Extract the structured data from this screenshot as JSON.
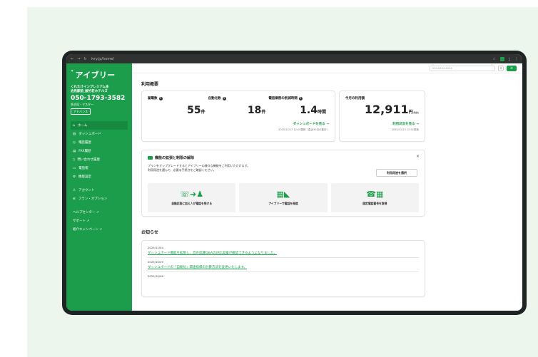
{
  "browser": {
    "url": "ivry.jp/home/"
  },
  "sidebar": {
    "logo": "アイブリー",
    "shop_line1": "くれたけインプレミアム多",
    "shop_line2": "治見駅前_飯竹荘ホテルズ",
    "phone": "050-1793-3582",
    "shop_sub": "多治見・マスター",
    "badge": "アドバンス",
    "items": [
      {
        "label": "ホーム",
        "icon": "home-icon"
      },
      {
        "label": "ダッシュボード",
        "icon": "chart-icon"
      },
      {
        "label": "電話履歴",
        "icon": "clock-icon"
      },
      {
        "label": "FAX履歴",
        "icon": "fax-icon"
      },
      {
        "label": "問い合わせ履歴",
        "icon": "document-icon"
      },
      {
        "label": "電話帳",
        "icon": "book-icon"
      },
      {
        "label": "機能設定",
        "icon": "gear-icon"
      }
    ],
    "items2": [
      {
        "label": "アカウント",
        "icon": "user-icon"
      },
      {
        "label": "プラン・オプション",
        "icon": "plan-icon"
      }
    ],
    "links": [
      {
        "label": "ヘルプセンター"
      },
      {
        "label": "サポート"
      },
      {
        "label": "紹介キャンペーン"
      }
    ]
  },
  "topbar": {
    "search_placeholder": "050-XXXX-XXXX"
  },
  "usage": {
    "title": "利用概要",
    "incoming_label": "着電数",
    "incoming_value": "55",
    "incoming_unit": "件",
    "auto_label": "自動化数",
    "auto_value": "18",
    "auto_unit": "件",
    "reduction_label": "電話業務の削減時間",
    "reduction_value": "1.4",
    "reduction_unit": "時間",
    "dashboard_link": "ダッシュボードを見る →",
    "dashboard_note": "2025/12/13 12:00更新（直近30日の集計）",
    "fee_label": "今月の利用額",
    "fee_value": "12,911",
    "fee_unit": "円",
    "fee_tax": "(税抜)",
    "fee_link": "利用状況を見る →",
    "fee_note": "2025/12/13 12:51更新"
  },
  "extension": {
    "title": "機能の拡張と制限の解除",
    "desc1": "プランをアップグレードするとアイブリーの様々な機能をご利用いただけます。",
    "desc2": "利用用途を選んで、必要な手続きをご確認ください。",
    "select_button": "利用用途を選択",
    "close": "×",
    "tiles": [
      {
        "label": "自動応答に加え人が電話を受ける",
        "icon": "phone-person-icon"
      },
      {
        "label": "アイブリーで電話を発信",
        "icon": "outgoing-call-icon"
      },
      {
        "label": "固定電話番号を取得",
        "icon": "landline-icon"
      }
    ]
  },
  "news": {
    "title": "お知らせ",
    "items": [
      {
        "date": "2025/11/04",
        "text": "ダッシュボード機能を拡張し、音声認識Q&Aの対応実績が確認できるようになりました。"
      },
      {
        "date": "2025/10/29",
        "text": "ダッシュボードの「自動化」関連指標の計算方法を変更いたします。"
      },
      {
        "date": "2025/10/06",
        "text": ""
      }
    ]
  }
}
